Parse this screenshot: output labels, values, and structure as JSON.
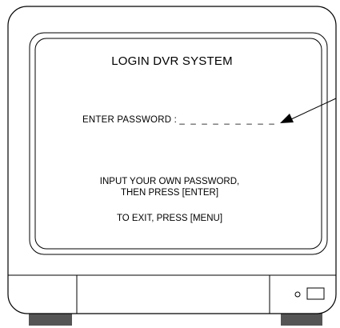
{
  "screen": {
    "title": "LOGIN DVR SYSTEM",
    "password_label": "ENTER PASSWORD  :",
    "password_mask": "_ _ _ _ _ _ _ _ _",
    "instruction_line1": "INPUT YOUR OWN PASSWORD,",
    "instruction_line2": "THEN PRESS [ENTER]",
    "exit_hint": "TO EXIT, PRESS [MENU]"
  },
  "icons": {
    "pointer": "arrow-icon",
    "power": "power-led-icon",
    "button": "front-button-icon"
  },
  "colors": {
    "screen_background": "#ffffff",
    "line": "#000000",
    "feet": "#555555"
  }
}
